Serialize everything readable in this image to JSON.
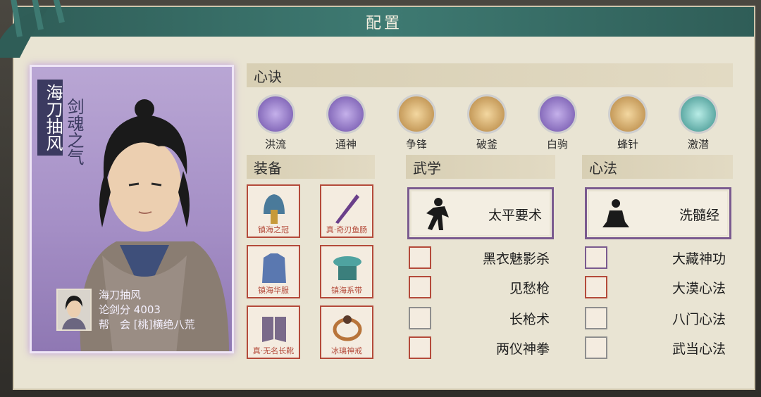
{
  "window": {
    "title": "配置"
  },
  "character": {
    "title": "海刀抽风",
    "subtitle": "剑魂之气",
    "name": "海刀抽风",
    "score_label": "论剑分",
    "score_value": "4003",
    "guild_label": "帮　会",
    "guild_value": "[桃]横绝八荒"
  },
  "sections": {
    "xinjue": "心诀",
    "equipment": "装备",
    "wuxue": "武学",
    "xinfa": "心法"
  },
  "xinjue": [
    {
      "label": "洪流",
      "color": "#8a6bc6"
    },
    {
      "label": "通神",
      "color": "#8a6bc6"
    },
    {
      "label": "争锋",
      "color": "#d4a25a"
    },
    {
      "label": "破釜",
      "color": "#d4a25a"
    },
    {
      "label": "白驹",
      "color": "#8a6bc6"
    },
    {
      "label": "蜂针",
      "color": "#d4a25a"
    },
    {
      "label": "激潜",
      "color": "#4fb3b0"
    }
  ],
  "equipment": [
    {
      "label": "镇海之冠",
      "icon": "helmet-icon"
    },
    {
      "label": "真·奇刃鱼肠",
      "icon": "dagger-icon"
    },
    {
      "label": "镇海华服",
      "icon": "armor-icon"
    },
    {
      "label": "镇海系带",
      "icon": "belt-icon"
    },
    {
      "label": "真·无名长靴",
      "icon": "boots-icon"
    },
    {
      "label": "冰璃神戒",
      "icon": "ring-icon"
    }
  ],
  "wuxue": {
    "main": "太平要术",
    "list": [
      "黑衣魅影杀",
      "见愁枪",
      "长枪术",
      "两仪神拳"
    ]
  },
  "xinfa": {
    "main": "洗髓经",
    "list": [
      "大藏神功",
      "大漠心法",
      "八门心法",
      "武当心法"
    ]
  }
}
